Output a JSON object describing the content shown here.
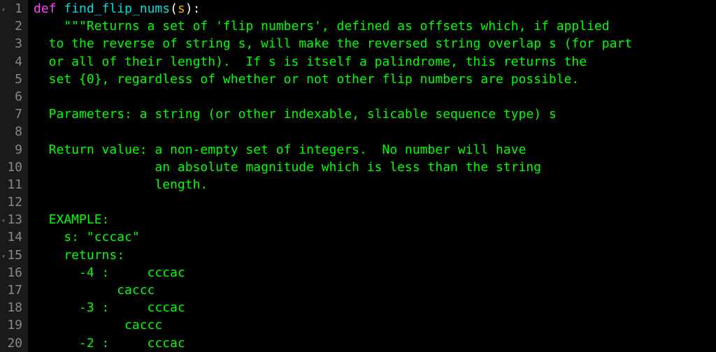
{
  "lines": [
    {
      "num": 1,
      "fold": true,
      "segments": [
        {
          "t": "def ",
          "c": "kw"
        },
        {
          "t": "find_flip_nums",
          "c": "fn"
        },
        {
          "t": "(",
          "c": "paren"
        },
        {
          "t": "s",
          "c": "param"
        },
        {
          "t": ")",
          "c": "paren"
        },
        {
          "t": ":",
          "c": "colon"
        }
      ]
    },
    {
      "num": 2,
      "fold": false,
      "segments": [
        {
          "t": "    \"\"\"Returns a set of 'flip numbers', defined as offsets which, if applied",
          "c": "str"
        }
      ]
    },
    {
      "num": 3,
      "fold": false,
      "segments": [
        {
          "t": "  to the reverse of string s, will make the reversed string overlap s (for part",
          "c": "str"
        }
      ]
    },
    {
      "num": 4,
      "fold": false,
      "segments": [
        {
          "t": "  or all of their length).  If s is itself a palindrome, this returns the",
          "c": "str"
        }
      ]
    },
    {
      "num": 5,
      "fold": false,
      "segments": [
        {
          "t": "  set {0}, regardless of whether or not other flip numbers are possible.",
          "c": "str"
        }
      ]
    },
    {
      "num": 6,
      "fold": false,
      "segments": []
    },
    {
      "num": 7,
      "fold": false,
      "segments": [
        {
          "t": "  Parameters: a string (or other indexable, slicable sequence type) s",
          "c": "str"
        }
      ]
    },
    {
      "num": 8,
      "fold": false,
      "segments": []
    },
    {
      "num": 9,
      "fold": false,
      "segments": [
        {
          "t": "  Return value: a non-empty set of integers.  No number will have",
          "c": "str"
        }
      ]
    },
    {
      "num": 10,
      "fold": false,
      "segments": [
        {
          "t": "                an absolute magnitude which is less than the string",
          "c": "str"
        }
      ]
    },
    {
      "num": 11,
      "fold": false,
      "segments": [
        {
          "t": "                length.",
          "c": "str"
        }
      ]
    },
    {
      "num": 12,
      "fold": false,
      "segments": []
    },
    {
      "num": 13,
      "fold": true,
      "segments": [
        {
          "t": "  EXAMPLE:",
          "c": "str"
        }
      ]
    },
    {
      "num": 14,
      "fold": false,
      "segments": [
        {
          "t": "    s: \"cccac\"",
          "c": "str"
        }
      ]
    },
    {
      "num": 15,
      "fold": true,
      "segments": [
        {
          "t": "    returns:",
          "c": "str"
        }
      ]
    },
    {
      "num": 16,
      "fold": false,
      "segments": [
        {
          "t": "      -4 :     cccac",
          "c": "str"
        }
      ]
    },
    {
      "num": 17,
      "fold": false,
      "segments": [
        {
          "t": "           caccc",
          "c": "str"
        }
      ]
    },
    {
      "num": 18,
      "fold": false,
      "segments": [
        {
          "t": "      -3 :     cccac",
          "c": "str"
        }
      ]
    },
    {
      "num": 19,
      "fold": false,
      "segments": [
        {
          "t": "            caccc",
          "c": "str"
        }
      ]
    },
    {
      "num": 20,
      "fold": false,
      "segments": [
        {
          "t": "      -2 :     cccac",
          "c": "str"
        }
      ]
    }
  ],
  "fold_glyph": "▸",
  "fold_open_glyph": "▾"
}
